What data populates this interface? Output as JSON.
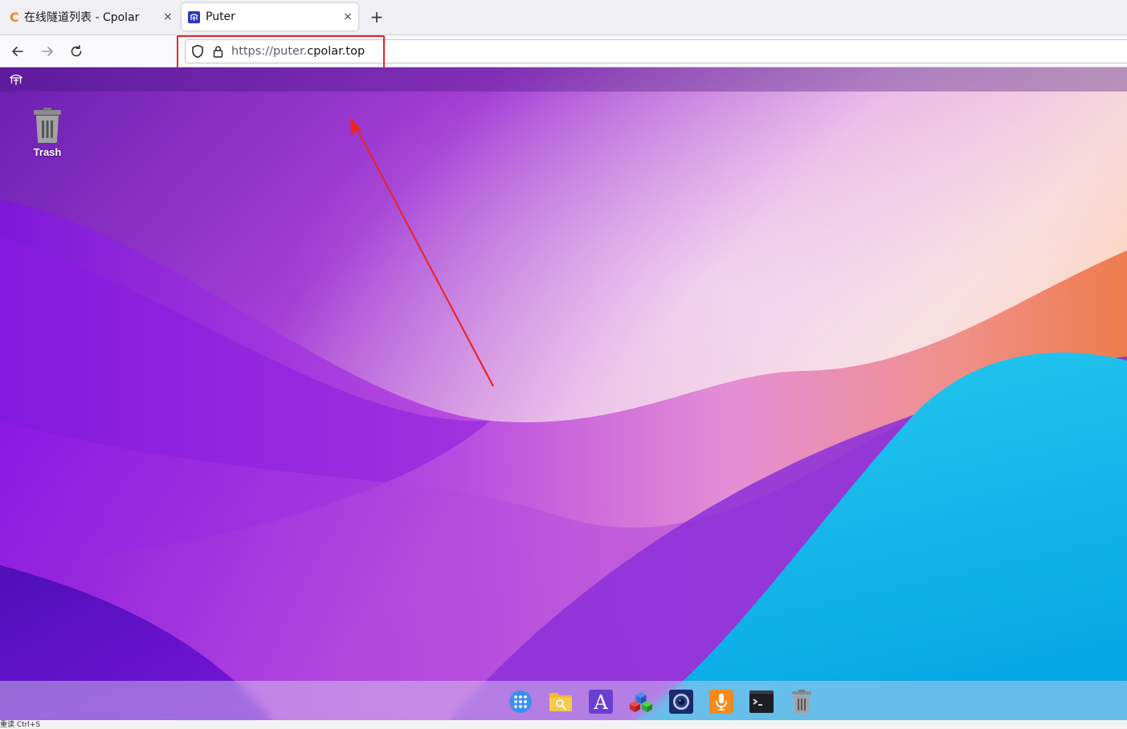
{
  "browser": {
    "tabs": [
      {
        "label": "在线隧道列表 - Cpolar",
        "favicon": "cpolar-c-icon",
        "active": false
      },
      {
        "label": "Puter",
        "favicon": "puter-icon",
        "active": true
      }
    ],
    "close_glyph": "×",
    "new_tab_glyph": "+",
    "url": {
      "scheme_prefix": "https://puter.",
      "host": "cpolar.top"
    }
  },
  "desktop": {
    "icons": [
      {
        "label": "Trash",
        "icon": "trash-icon"
      }
    ],
    "taskbar": [
      {
        "name": "app-launcher",
        "icon": "grid-icon"
      },
      {
        "name": "file-explorer",
        "icon": "folder-search-icon"
      },
      {
        "name": "text-editor",
        "icon": "letter-a-icon"
      },
      {
        "name": "app-center",
        "icon": "cubes-icon"
      },
      {
        "name": "camera",
        "icon": "camera-icon"
      },
      {
        "name": "recorder",
        "icon": "microphone-icon"
      },
      {
        "name": "terminal",
        "icon": "terminal-icon"
      },
      {
        "name": "trash",
        "icon": "trash-icon"
      }
    ]
  },
  "annotation": {
    "box_color": "#e8262a",
    "arrow_color": "#e8262a"
  },
  "status_text": "重读 Ctrl+S"
}
